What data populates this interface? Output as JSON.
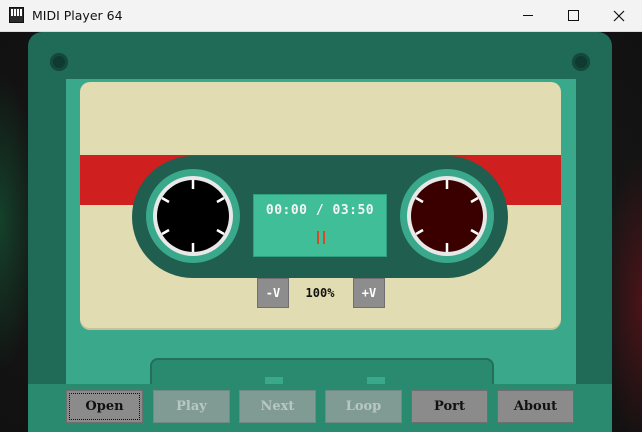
{
  "window": {
    "title": "MIDI Player 64",
    "controls": [
      "minimize",
      "maximize",
      "close"
    ]
  },
  "player": {
    "time_display": "00:00 / 03:50",
    "state_icon": "pause-icon",
    "volume": {
      "decrease_label": "-V",
      "value": "100%",
      "increase_label": "+V"
    }
  },
  "buttons": {
    "open": "Open",
    "play": "Play",
    "next": "Next",
    "loop": "Loop",
    "port": "Port",
    "about": "About"
  },
  "colors": {
    "shell": "#1f6b57",
    "window": "#3aa88a",
    "label": "#e1dcb1",
    "stripe": "#cf1f1f",
    "display": "#3fbe98",
    "left_reel_hub": "#000000",
    "right_reel_hub": "#3a0000"
  }
}
